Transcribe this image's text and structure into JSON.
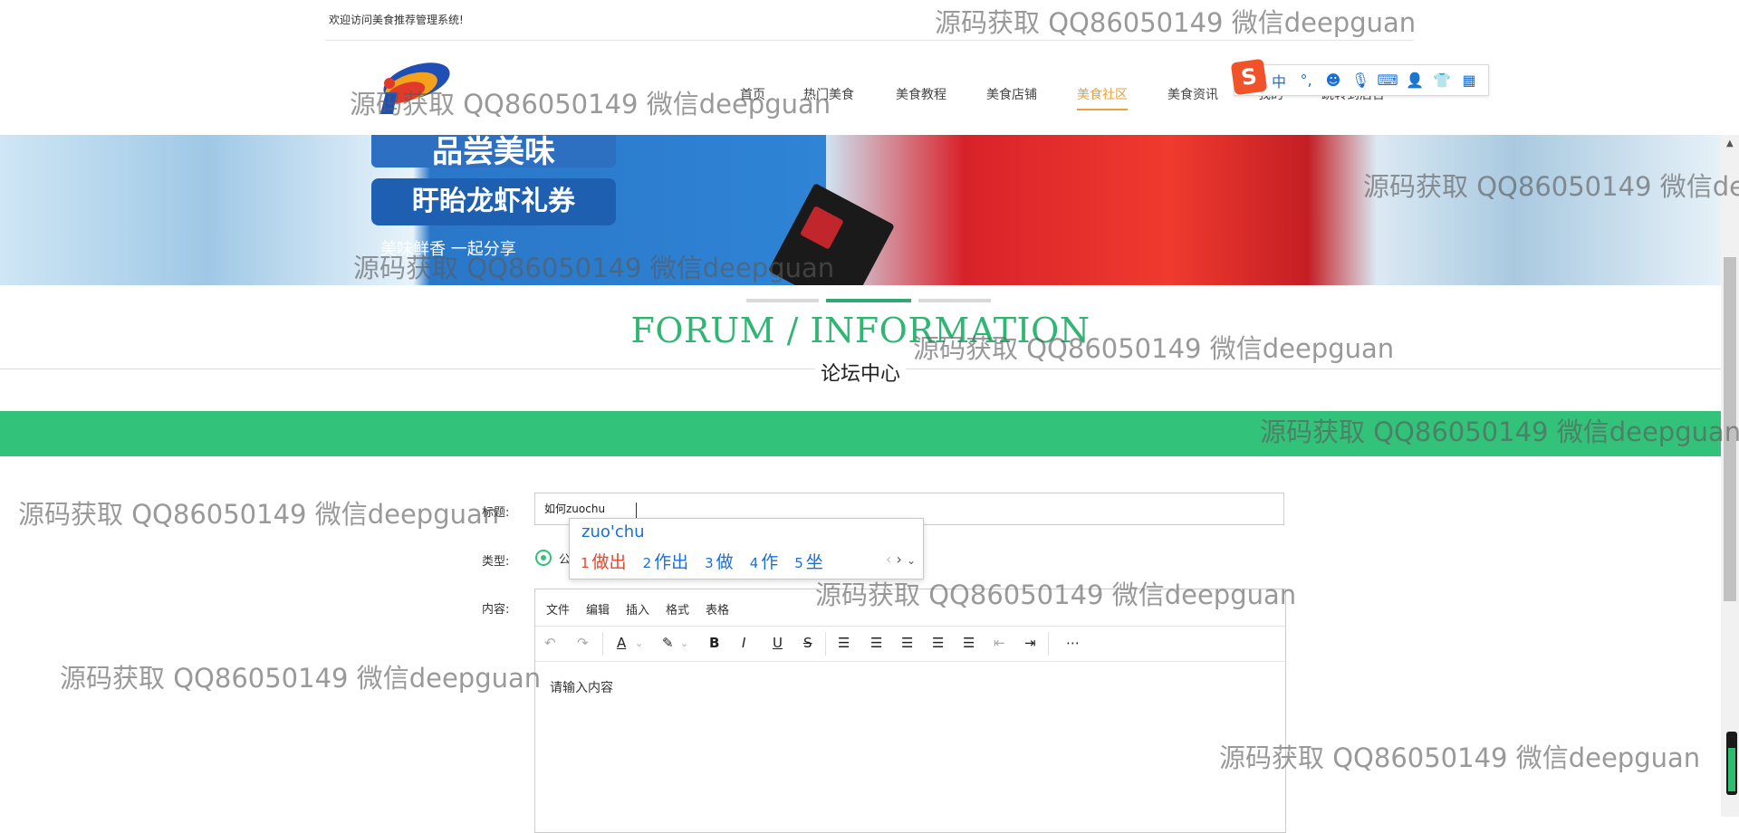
{
  "topbar": {
    "welcome": "欢迎访问美食推荐管理系统!"
  },
  "nav": {
    "items": [
      {
        "label": "首页",
        "active": false
      },
      {
        "label": "热门美食",
        "active": false
      },
      {
        "label": "美食教程",
        "active": false
      },
      {
        "label": "美食店铺",
        "active": false
      },
      {
        "label": "美食社区",
        "active": true
      },
      {
        "label": "美食资讯",
        "active": false
      },
      {
        "label": "我的",
        "active": false
      },
      {
        "label": "跳转到后台",
        "active": false
      }
    ]
  },
  "ime_toolbar": {
    "logo": "S",
    "lang": "中",
    "punct": "°,"
  },
  "banner": {
    "line1": "品尝美味",
    "line2": "盱眙龙虾礼券",
    "line3": "美味鲜香 一起分享"
  },
  "section": {
    "title": "FORUM / INFORMATION",
    "subtitle": "论坛中心"
  },
  "form": {
    "title_label": "标题:",
    "title_value": "如何zuochu",
    "type_label": "类型:",
    "type_option": "公",
    "content_label": "内容:"
  },
  "ime_popup": {
    "pinyin": "zuo'chu",
    "candidates": [
      {
        "num": "1",
        "text": "做出"
      },
      {
        "num": "2",
        "text": "作出"
      },
      {
        "num": "3",
        "text": "做"
      },
      {
        "num": "4",
        "text": "作"
      },
      {
        "num": "5",
        "text": "坐"
      }
    ]
  },
  "editor": {
    "menus": [
      "文件",
      "编辑",
      "插入",
      "格式",
      "表格"
    ],
    "placeholder": "请输入内容",
    "toolbar_icons": [
      "undo-icon",
      "redo-icon",
      "font-color-icon",
      "highlight-icon",
      "bold-icon",
      "italic-icon",
      "underline-icon",
      "strikethrough-icon",
      "line-height-icon",
      "align-left-icon",
      "align-center-icon",
      "align-right-icon",
      "align-justify-icon",
      "outdent-icon",
      "indent-icon",
      "more-icon"
    ]
  },
  "watermark": "源码获取 QQ86050149 微信deepguan",
  "colors": {
    "accent": "#33c27a",
    "forum_title": "#2fb673",
    "nav_active": "#e6a23c",
    "ime_blue": "#1a6fd6",
    "ime_red": "#e8452a"
  }
}
